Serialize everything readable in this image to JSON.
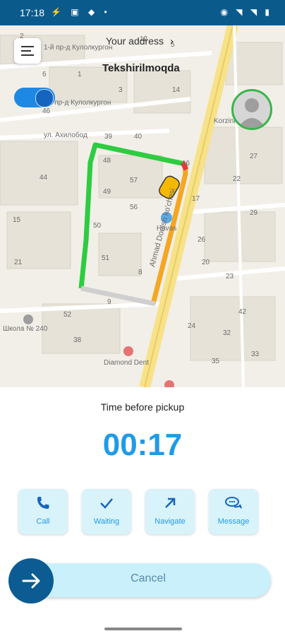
{
  "status_bar": {
    "time": "17:18",
    "left_icons": "⚡ ▣ ◆ •",
    "right_icons": "◉ ◥ ◥ ▮"
  },
  "header": {
    "address_title": "Your address",
    "address_chevron": "›",
    "address_status": "Tekshirilmoqda"
  },
  "map": {
    "labels": [
      "1-й пр-д Кулолкургон",
      "4-й пр-д Кулолкургон",
      "ул. Ахилобод",
      "Ahmad Donish ko'chasi",
      "Havas",
      "Школа № 240",
      "Diamond Dent",
      "Korzinka",
      "1",
      "2",
      "3",
      "5",
      "6",
      "12",
      "14",
      "16",
      "17",
      "20",
      "39",
      "40",
      "44",
      "46",
      "48",
      "49",
      "50",
      "51",
      "57",
      "56",
      "8",
      "9",
      "15",
      "21",
      "26",
      "27",
      "29",
      "22",
      "23",
      "24",
      "32",
      "33",
      "38",
      "42",
      "52",
      "35"
    ]
  },
  "driver_status": {
    "online": true
  },
  "pickup": {
    "label": "Time before pickup",
    "timer": "00:17"
  },
  "actions": [
    {
      "label": "Call",
      "icon": "phone-icon"
    },
    {
      "label": "Waiting",
      "icon": "check-icon"
    },
    {
      "label": "Navigate",
      "icon": "arrow-up-right-icon"
    },
    {
      "label": "Message",
      "icon": "chat-bubbles-icon"
    }
  ],
  "cancel": {
    "label": "Cancel",
    "icon": "arrow-right-icon"
  },
  "colors": {
    "accent": "#1e9be8",
    "primary_dark": "#0c5c93",
    "action_bg": "#d9f3fb",
    "route_green": "#2ecc40",
    "route_orange": "#f5a623",
    "road_yellow": "#f7e28a"
  }
}
